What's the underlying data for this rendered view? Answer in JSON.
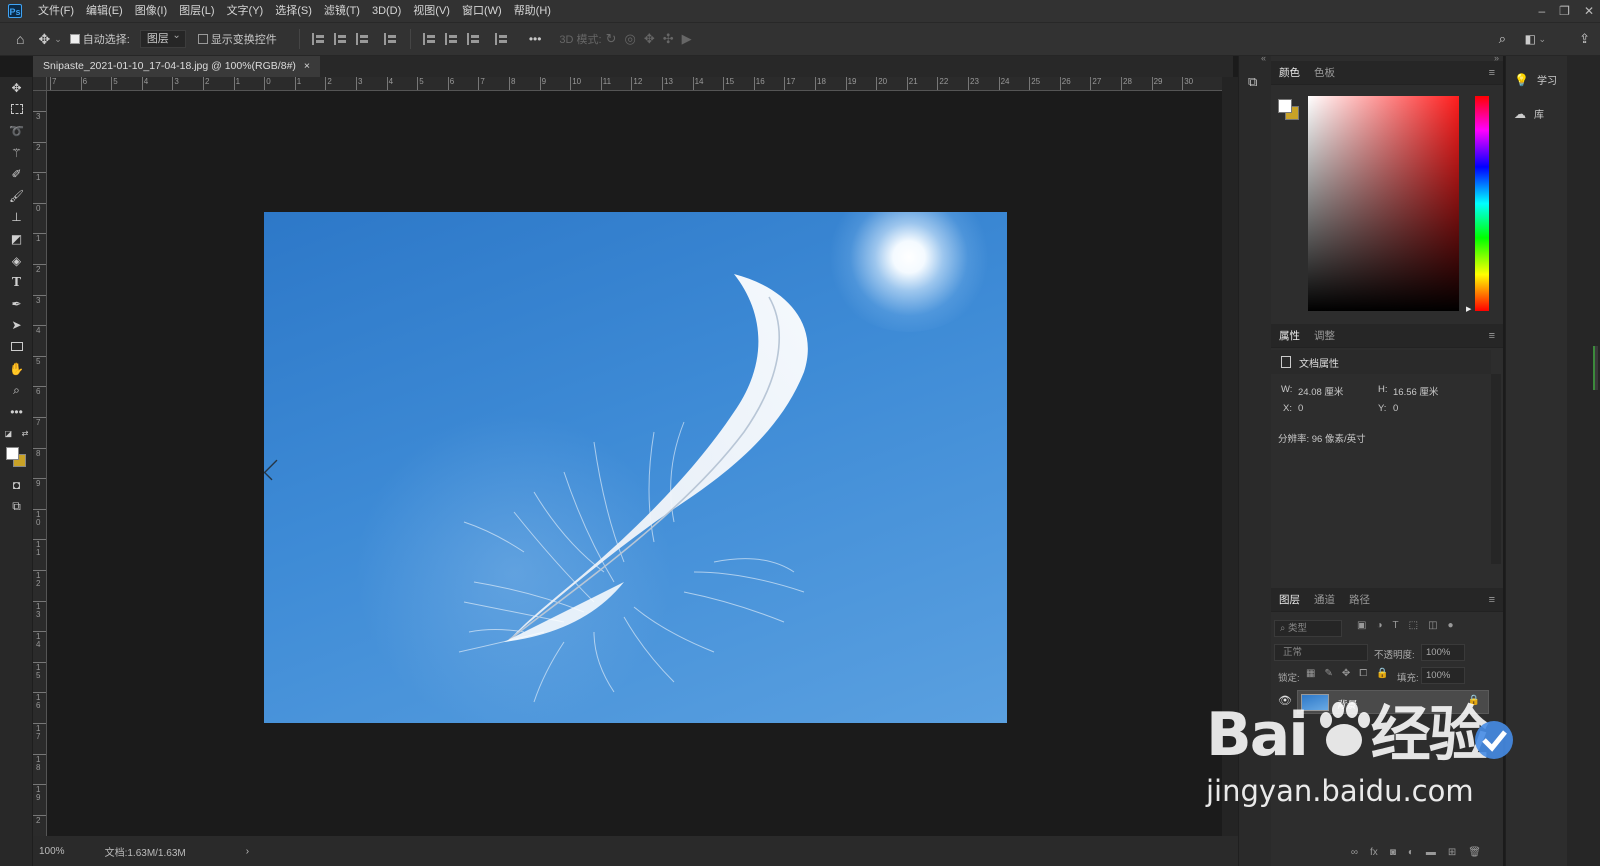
{
  "app": {
    "logo": "Ps"
  },
  "menu": [
    "文件(F)",
    "编辑(E)",
    "图像(I)",
    "图层(L)",
    "文字(Y)",
    "选择(S)",
    "滤镜(T)",
    "3D(D)",
    "视图(V)",
    "窗口(W)",
    "帮助(H)"
  ],
  "options": {
    "auto_select_label": "自动选择:",
    "auto_select_value": "图层",
    "show_transform_label": "显示变换控件",
    "more": "•••",
    "mode_3d_label": "3D 模式:"
  },
  "document": {
    "tab_title": "Snipaste_2021-01-10_17-04-18.jpg @ 100%(RGB/8#)",
    "close": "×"
  },
  "ruler": {
    "h_ticks": [
      "7",
      "6",
      "5",
      "4",
      "3",
      "2",
      "1",
      "0",
      "1",
      "2",
      "3",
      "4",
      "5",
      "6",
      "7",
      "8",
      "9",
      "10",
      "11",
      "12",
      "13",
      "14",
      "15",
      "16",
      "17",
      "18",
      "19",
      "20",
      "21",
      "22",
      "23",
      "24",
      "25",
      "26",
      "27",
      "28",
      "29",
      "30"
    ],
    "v_ticks": [
      "3",
      "2",
      "1",
      "0",
      "1",
      "2",
      "3",
      "4",
      "5",
      "6",
      "7",
      "8",
      "9",
      "1 0",
      "1 1",
      "1 2",
      "1 3",
      "1 4",
      "1 5",
      "1 6",
      "1 7",
      "1 8",
      "1 9",
      "2"
    ]
  },
  "status": {
    "zoom": "100%",
    "doc": "文档:1.63M/1.63M",
    "arrow": "›"
  },
  "color_panel": {
    "tabs": [
      "颜色",
      "色板"
    ]
  },
  "properties_panel": {
    "tabs": [
      "属性",
      "调整"
    ],
    "section": "文档属性",
    "w_label": "W:",
    "w_value": "24.08 厘米",
    "h_label": "H:",
    "h_value": "16.56 厘米",
    "x_label": "X:",
    "x_value": "0",
    "y_label": "Y:",
    "y_value": "0",
    "resolution": "分辨率: 96 像素/英寸"
  },
  "layers_panel": {
    "tabs": [
      "图层",
      "通道",
      "路径"
    ],
    "filter_placeholder": "类型",
    "blend_mode": "正常",
    "opacity_label": "不透明度:",
    "opacity_value": "100%",
    "lock_label": "锁定:",
    "fill_label": "填充:",
    "fill_value": "100%",
    "layer_name": "背景"
  },
  "side_links": {
    "learn": "学习",
    "library": "库"
  },
  "watermark": {
    "brand": "Bai",
    "brand2": "经验",
    "url": "jingyan.baidu.com"
  },
  "colors": {
    "fg": "#ffffff",
    "bg": "#c9a227",
    "ui_dark": "#1b1b1b",
    "panel": "#2d2d2d"
  }
}
